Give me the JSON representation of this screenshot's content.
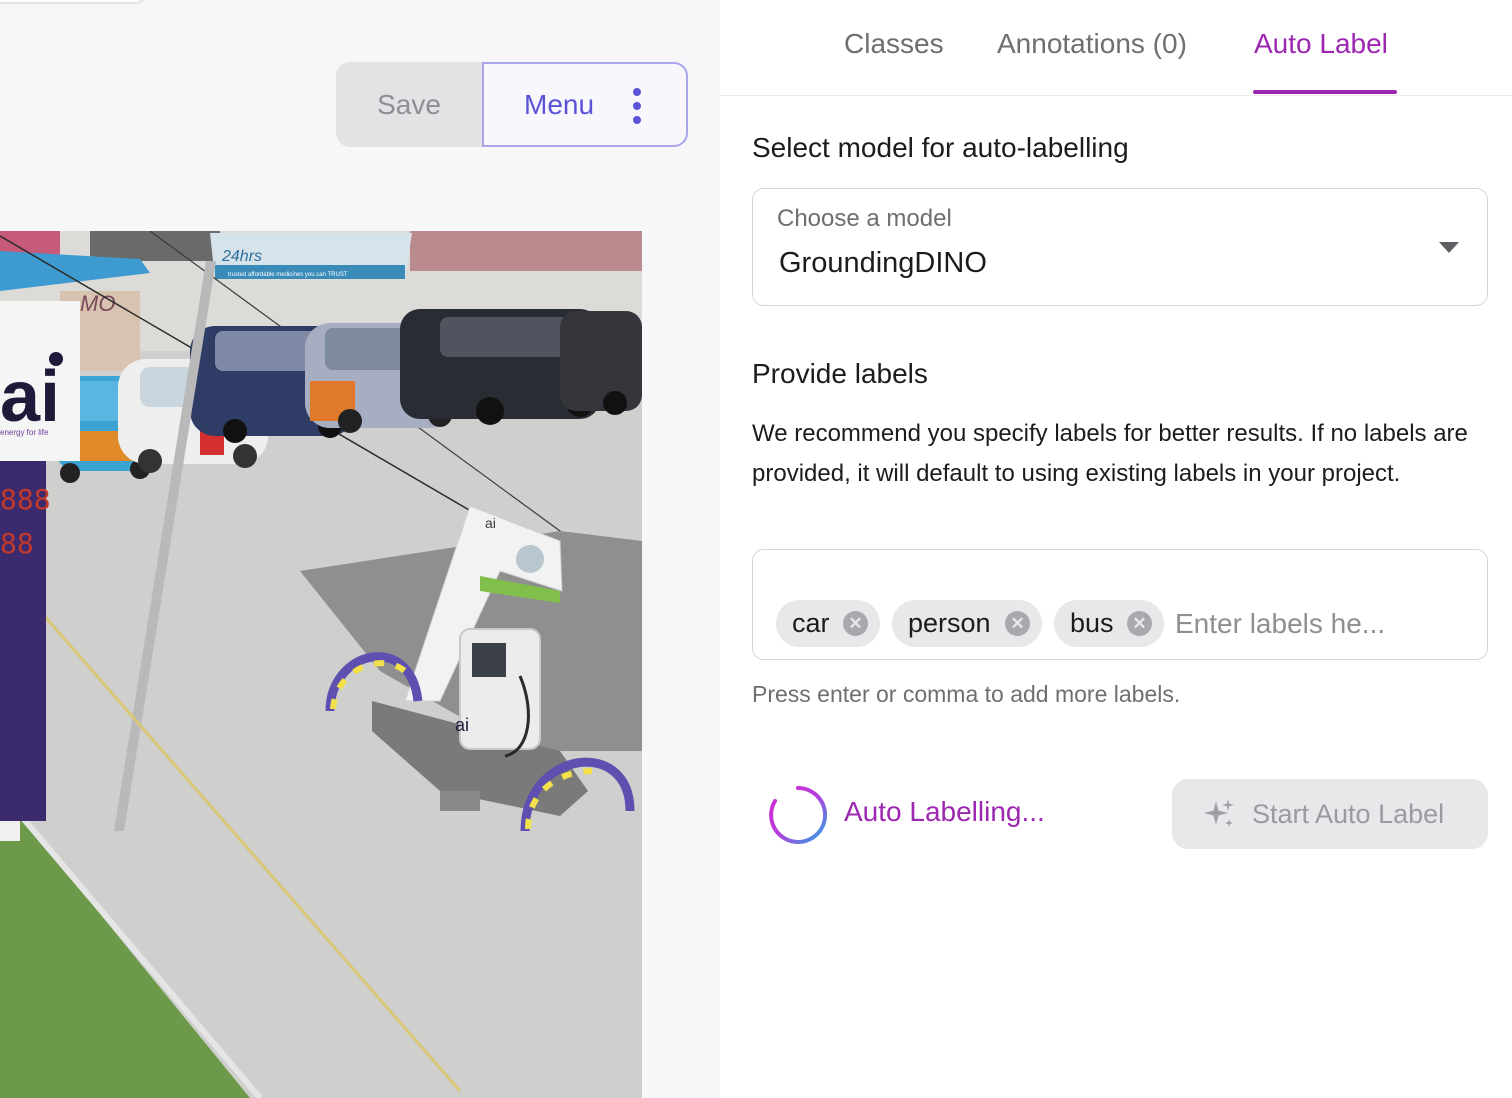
{
  "toolbar": {
    "save_label": "Save",
    "menu_label": "Menu",
    "menu_icon": "kebab-vertical-icon"
  },
  "image": {
    "sign_text": "24hrs",
    "banner_text": "trusted affordable medicines you can TRUST",
    "pump_brand": "ai",
    "station_brand": "ai",
    "station_tagline": "energy for life",
    "price_digits_1": "888",
    "price_digits_2": "88",
    "wall_text": "MO"
  },
  "tabs": [
    {
      "label": "Classes"
    },
    {
      "label": "Annotations (0)"
    },
    {
      "label": "Auto Label"
    }
  ],
  "active_tab": "Auto Label",
  "model_section": {
    "title": "Select model for auto-labelling",
    "select_caption": "Choose a model",
    "selected_model": "GroundingDINO"
  },
  "labels_section": {
    "title": "Provide labels",
    "description": "We recommend you specify labels for better results. If no labels are provided, it will default to using existing labels in your project.",
    "chips": [
      "car",
      "person",
      "bus"
    ],
    "input_placeholder": "Enter labels he...",
    "helper": "Press enter or comma to add more labels."
  },
  "status": {
    "text": "Auto Labelling...",
    "icon": "spinner-icon"
  },
  "start_button": {
    "label": "Start Auto Label",
    "icon": "sparkle-icon"
  },
  "colors": {
    "accent": "#9c27b0",
    "menu_accent": "#5a53d8",
    "disabled_bg": "#e8e8eb"
  }
}
